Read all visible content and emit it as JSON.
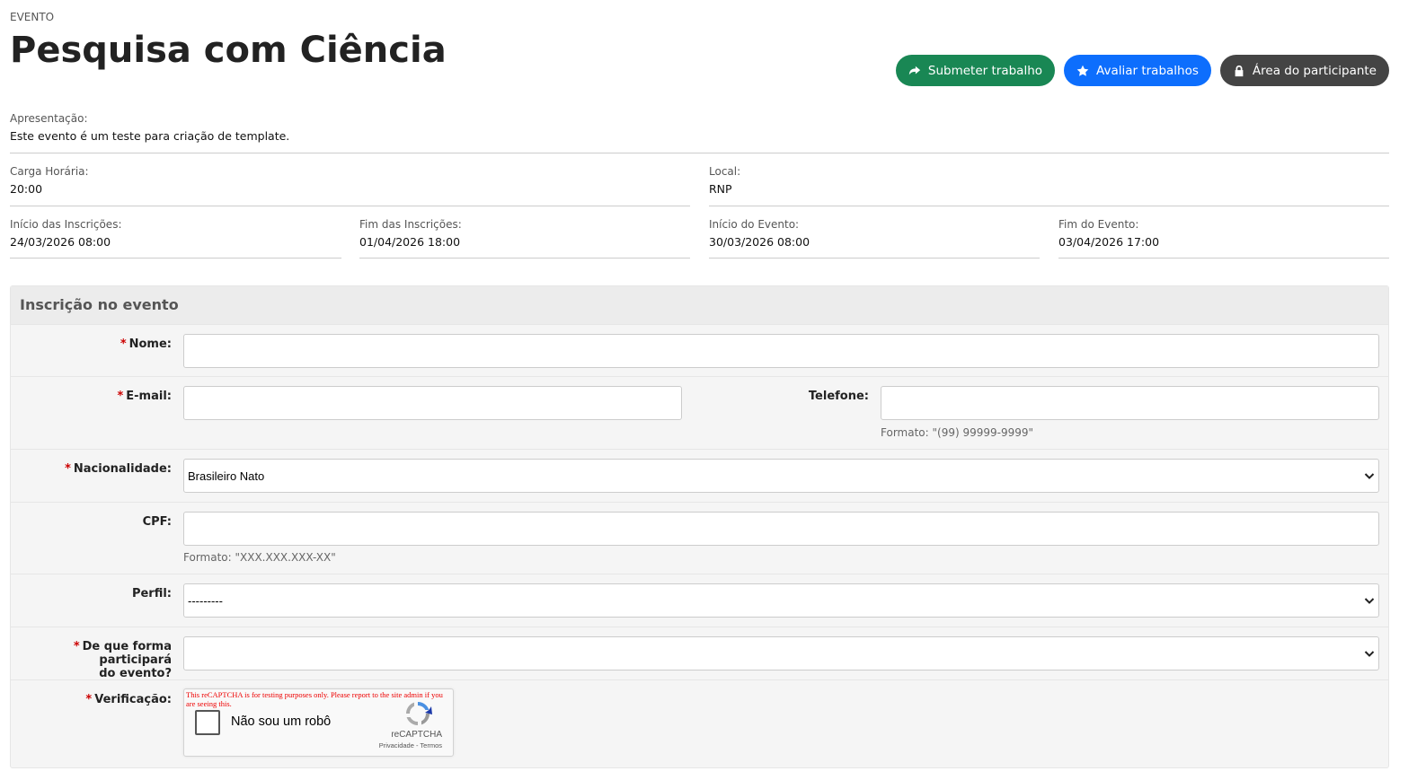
{
  "header": {
    "eyebrow": "EVENTO",
    "title": "Pesquisa com Ciência"
  },
  "actions": {
    "submit_label": "Submeter trabalho",
    "evaluate_label": "Avaliar trabalhos",
    "participant_label": "Área do participante"
  },
  "colors": {
    "green": "#198754",
    "blue": "#0d6efd",
    "dark": "#444444",
    "required": "#cc0000"
  },
  "info": {
    "presentation_label": "Apresentação:",
    "presentation_value": "Este evento é um teste para criação de template.",
    "workload_label": "Carga Horária:",
    "workload_value": "20:00",
    "location_label": "Local:",
    "location_value": "RNP",
    "reg_start_label": "Início das Inscrições:",
    "reg_start_value": "24/03/2026 08:00",
    "reg_end_label": "Fim das Inscrições:",
    "reg_end_value": "01/04/2026 18:00",
    "event_start_label": "Início do Evento:",
    "event_start_value": "30/03/2026 08:00",
    "event_end_label": "Fim do Evento:",
    "event_end_value": "03/04/2026 17:00"
  },
  "form": {
    "title": "Inscrição no evento",
    "required_mark": "*",
    "name_label": "Nome:",
    "name_value": "",
    "email_label": "E-mail:",
    "email_value": "",
    "phone_label": "Telefone:",
    "phone_value": "",
    "phone_hint": "Formato: \"(99) 99999-9999\"",
    "nationality_label": "Nacionalidade:",
    "nationality_value": "Brasileiro Nato",
    "cpf_label": "CPF:",
    "cpf_value": "",
    "cpf_hint": "Formato: \"XXX.XXX.XXX-XX\"",
    "profile_label": "Perfil:",
    "profile_value": "---------",
    "participation_label_1": "De que forma participará",
    "participation_label_2": "do evento?",
    "participation_value": "",
    "verification_label": "Verificação:"
  },
  "captcha": {
    "warning": "This reCAPTCHA is for testing purposes only. Please report to the site admin if you are seeing this.",
    "checkbox_label": "Não sou um robô",
    "brand": "reCAPTCHA",
    "links": "Privacidade - Termos",
    "logo_icon": "recaptcha-icon"
  }
}
